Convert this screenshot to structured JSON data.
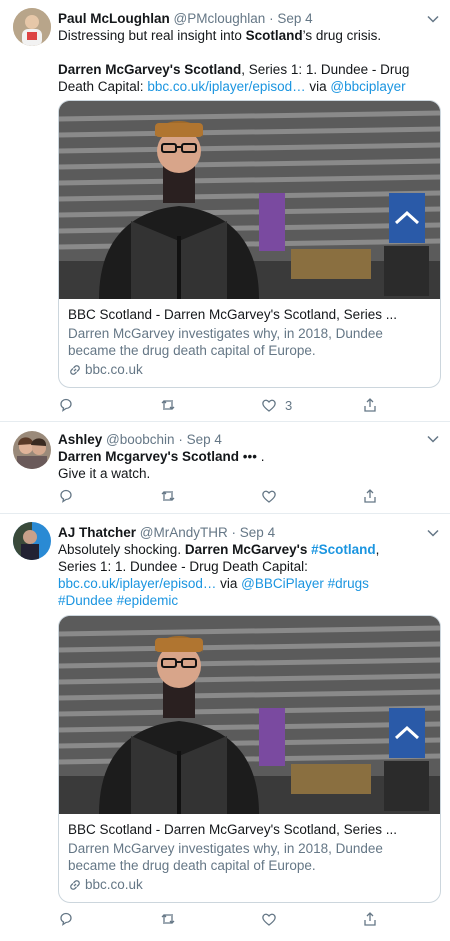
{
  "colors": {
    "link": "#1b95e0",
    "muted": "#657786",
    "border": "#e6ecf0"
  },
  "tweets": [
    {
      "name": "Paul McLoughlan",
      "handle": "@PMcloughlan",
      "sep": "·",
      "time": "Sep 4",
      "text_line1_a": "Distressing but real insight into ",
      "text_line1_b": "Scotland",
      "text_line1_c": "’s drug crisis.",
      "text_line2_a": "Darren McGarvey's Scotland",
      "text_line2_b": ", Series 1: 1. Dundee - Drug",
      "text_line3_a": "Death Capital: ",
      "text_line3_link": "bbc.co.uk/iplayer/episod…",
      "text_line3_via": " via ",
      "text_line3_handle": "@bbciplayer",
      "card": {
        "title": "BBC Scotland - Darren McGarvey's Scotland, Series ...",
        "desc": "Darren McGarvey investigates why, in 2018, Dundee became the drug death capital of Europe.",
        "domain": "bbc.co.uk"
      },
      "like_count": "3",
      "icons": [
        "reply-icon",
        "retweet-icon",
        "like-icon",
        "share-icon"
      ]
    },
    {
      "name": "Ashley",
      "handle": "@boobchin",
      "sep": "·",
      "time": "Sep 4",
      "text_line1_a": "Darren Mcgarvey's Scotland",
      "text_line1_b": " ••• .",
      "text_line2": "Give it a watch."
    },
    {
      "name": "AJ Thatcher",
      "handle": "@MrAndyTHR",
      "sep": "·",
      "time": "Sep 4",
      "text_line1_a": "Absolutely shocking. ",
      "text_line1_b": "Darren McGarvey's",
      "text_line1_c": " ",
      "text_line1_d": "#Scotland",
      "text_line1_e": ",",
      "text_line2": "Series 1: 1. Dundee - Drug Death Capital:",
      "text_line3_link": "bbc.co.uk/iplayer/episod…",
      "text_line3_via": " via ",
      "text_line3_handle": "@BBCiPlayer",
      "text_line3_tag": "#drugs",
      "text_line4_tag1": "#Dundee",
      "text_line4_tag2": "#epidemic",
      "card": {
        "title": "BBC Scotland - Darren McGarvey's Scotland, Series ...",
        "desc": "Darren McGarvey investigates why, in 2018, Dundee became the drug death capital of Europe.",
        "domain": "bbc.co.uk"
      }
    }
  ]
}
